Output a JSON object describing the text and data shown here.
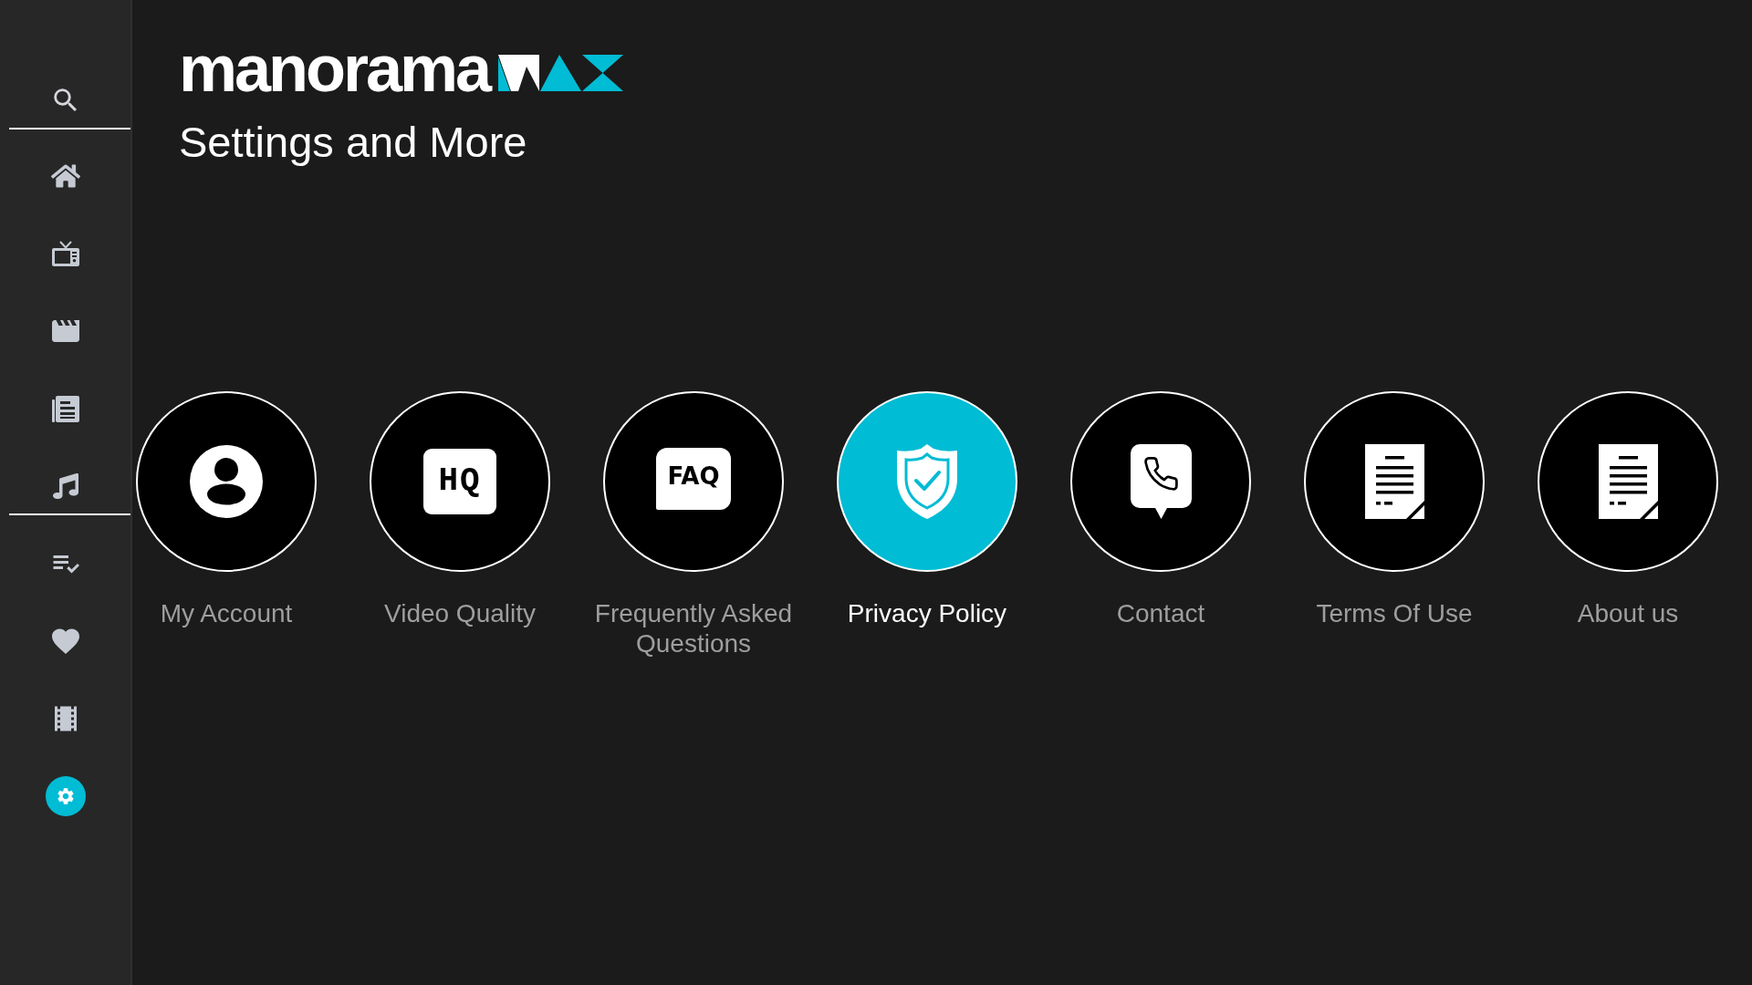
{
  "sidebar": {
    "groups": [
      {
        "items": [
          {
            "kind": "search",
            "selected": false
          }
        ]
      },
      {
        "items": [
          {
            "kind": "home",
            "selected": false
          },
          {
            "kind": "tv",
            "selected": false
          },
          {
            "kind": "movies",
            "selected": false
          },
          {
            "kind": "news",
            "selected": false
          },
          {
            "kind": "music",
            "selected": false
          }
        ]
      },
      {
        "items": [
          {
            "kind": "watchlist",
            "selected": false
          },
          {
            "kind": "favorites",
            "selected": false
          },
          {
            "kind": "films",
            "selected": false
          },
          {
            "kind": "settings",
            "selected": true
          }
        ]
      }
    ]
  },
  "logo": {
    "wordmark": "manorama"
  },
  "page_title": "Settings and More",
  "options": [
    {
      "kind": "account",
      "label": "My Account",
      "selected": false
    },
    {
      "kind": "badge",
      "badge": "HQ",
      "label": "Video Quality",
      "selected": false
    },
    {
      "kind": "bubble",
      "badge": "FAQ",
      "label": "Frequently Asked Questions",
      "selected": false
    },
    {
      "kind": "shield",
      "label": "Privacy Policy",
      "selected": true
    },
    {
      "kind": "phone",
      "label": "Contact",
      "selected": false
    },
    {
      "kind": "document",
      "label": "Terms Of Use",
      "selected": false
    },
    {
      "kind": "document",
      "label": "About us",
      "selected": false
    }
  ]
}
